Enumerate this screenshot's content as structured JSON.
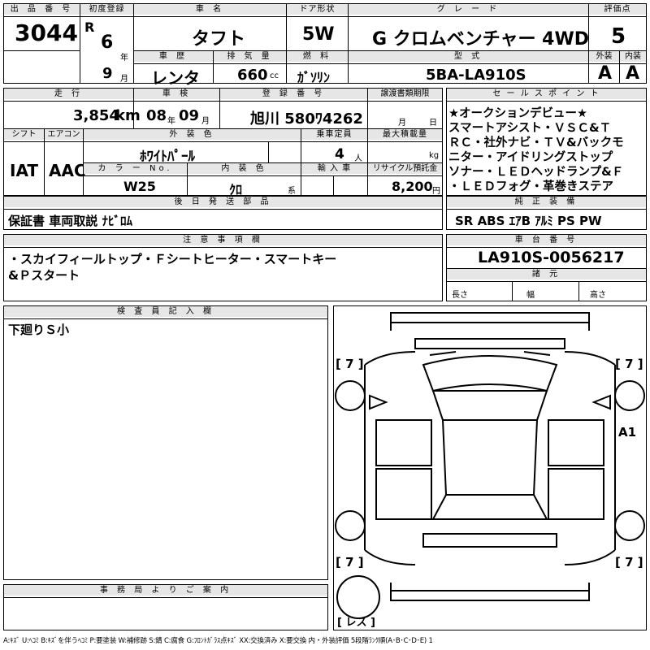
{
  "lot": {
    "label": "出 品 番 号",
    "value": "3044"
  },
  "first_reg": {
    "label": "初度登録",
    "era": "R",
    "year": "6",
    "year_unit": "年",
    "month": "9",
    "month_unit": "月"
  },
  "car_name": {
    "label": "車 名",
    "value": "タフト"
  },
  "door": {
    "label": "ドア形状",
    "value": "5W"
  },
  "grade": {
    "label": "グ レ ー ド",
    "value": "G クロムベンチャー 4WD"
  },
  "score": {
    "label": "評価点",
    "value": "5"
  },
  "history": {
    "label": "車 歴",
    "value": "レンタ"
  },
  "displacement": {
    "label": "排 気 量",
    "value": "660",
    "unit": "cc"
  },
  "fuel": {
    "label": "燃 料",
    "value": "ｶﾞｿﾘﾝ"
  },
  "model_code": {
    "label": "型 式",
    "value": "5BA-LA910S"
  },
  "exterior_grade": {
    "label": "外装",
    "value": "A"
  },
  "interior_grade": {
    "label": "内装",
    "value": "A"
  },
  "mileage": {
    "label": "走 行",
    "value": "3,854",
    "unit": "km"
  },
  "inspection": {
    "label": "車 検",
    "year": "08",
    "year_unit": "年",
    "month": "09",
    "month_unit": "月"
  },
  "reg_number": {
    "label": "登 録 番 号",
    "value": "旭川 580ﾜ4262"
  },
  "transfer_docs": {
    "label": "譲渡書類期限",
    "month_unit": "月",
    "day_unit": "日"
  },
  "shift": {
    "label": "シフト",
    "value": "IAT"
  },
  "aircon": {
    "label": "エアコン",
    "value": "AAC"
  },
  "color": {
    "label": "外 装 色",
    "value": "ﾎﾜｲﾄﾊﾟｰﾙ"
  },
  "capacity": {
    "label": "乗車定員",
    "value": "4",
    "unit": "人"
  },
  "max_load": {
    "label": "最大積載量",
    "unit": "kg"
  },
  "color_no": {
    "label": "カ ラ ー No.",
    "value": "W25"
  },
  "interior_color": {
    "label": "内 装 色",
    "value": "ｸﾛ",
    "unit": "系"
  },
  "import": {
    "label": "輸 入 車"
  },
  "recycle": {
    "label": "リサイクル預託金",
    "value": "8,200",
    "unit": "円"
  },
  "sales_points": {
    "label": "セ ー ル ス ポ イ ン ト",
    "lines": [
      "★オークションデビュー★",
      "スマートアシスト・ＶＳＣ&Ｔ",
      "ＲＣ・社外ナビ・ＴＶ&バックモ",
      "ニター・アイドリングストップ",
      "ソナー・ＬＥＤヘッドランプ&Ｆ",
      "・ＬＥＤフォグ・革巻きステア"
    ]
  },
  "later_parts": {
    "label": "後 日 発 送 部 品",
    "value": "保証書 車両取説 ﾅﾋﾞﾛﾑ"
  },
  "equipment": {
    "label": "純 正 装 備",
    "value": "SR ABS ｴｱB ｱﾙﾐ PS PW"
  },
  "notes": {
    "label": "注 意 事 項 欄",
    "line1": "・スカイフィールトップ・Ｆシートヒーター・スマートキー",
    "line2": "&Ｐスタート"
  },
  "chassis": {
    "label": "車 台 番 号",
    "value": "LA910S-0056217"
  },
  "specs": {
    "label": "諸 元",
    "length": "長さ",
    "width": "幅",
    "height": "高さ"
  },
  "inspector": {
    "label": "検 査 員 記 入 欄",
    "value": "下廻りＳ小"
  },
  "office": {
    "label": "事 務 局 よ り ご 案 内"
  },
  "diagram": {
    "marks": {
      "fl": "[ 7 ]",
      "fr": "[ 7 ]",
      "rl": "[ 7 ]",
      "rr": "[ 7 ]",
      "spare": "[ レス ]",
      "right_door": "A1"
    }
  },
  "legend": "A:ｷｽﾞ U:ﾍｺﾐ B:ｷｽﾞを伴うﾍｺﾐ P:要塗装 W:補修跡 S:錆 C:腐食 G:ﾌﾛﾝﾄｶﾞﾗｽ点ｷｽﾞ XX:交換済み X:要交換 内・外装評価 5段階ﾗﾝｸ順(A･B･C･D･E) 1"
}
